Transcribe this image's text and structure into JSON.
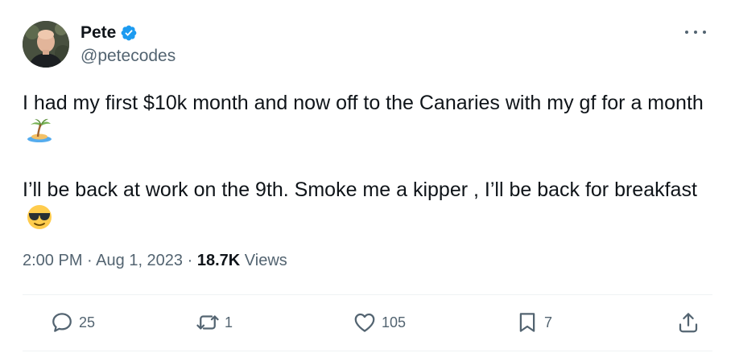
{
  "author": {
    "display_name": "Pete",
    "handle": "@petecodes",
    "verified": true
  },
  "tweet": {
    "paragraphs": [
      {
        "text": "I had my first $10k month and now off to the Canaries with my gf for a month",
        "emoji": "desert-island-emoji"
      },
      {
        "text": "I’ll be back at work on the 9th. Smoke me a kipper , I’ll be back for breakfast",
        "emoji": "sunglasses-face-emoji"
      }
    ],
    "time": "2:00 PM",
    "date": "Aug 1, 2023",
    "views_count": "18.7K",
    "views_label": "Views",
    "separator": "·"
  },
  "actions": {
    "replies": "25",
    "reposts": "1",
    "likes": "105",
    "bookmarks": "7"
  },
  "colors": {
    "text": "#0f1419",
    "secondary": "#536471",
    "verified_blue": "#1d9bf0",
    "divider": "#eff3f4"
  }
}
